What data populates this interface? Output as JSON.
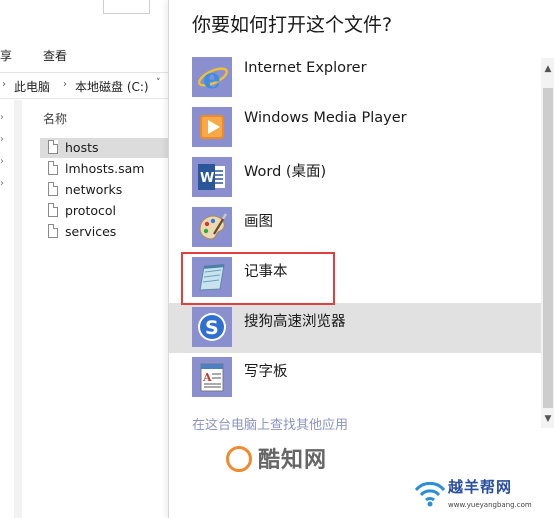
{
  "explorer": {
    "ribbon_tabs": [
      "享",
      "查看"
    ],
    "breadcrumb": [
      "此电脑",
      "本地磁盘 (C:)"
    ],
    "column_header": "名称",
    "files": [
      {
        "name": "hosts",
        "selected": true
      },
      {
        "name": "lmhosts.sam",
        "selected": false
      },
      {
        "name": "networks",
        "selected": false
      },
      {
        "name": "protocol",
        "selected": false
      },
      {
        "name": "services",
        "selected": false
      }
    ]
  },
  "dialog": {
    "title": "你要如何打开这个文件?",
    "apps": [
      {
        "label": "Internet Explorer",
        "icon": "internet-explorer-icon"
      },
      {
        "label": "Windows Media Player",
        "icon": "windows-media-player-icon"
      },
      {
        "label": "Word (桌面)",
        "icon": "word-icon"
      },
      {
        "label": "画图",
        "icon": "paint-icon"
      },
      {
        "label": "记事本",
        "icon": "notepad-icon",
        "annotated": true
      },
      {
        "label": "搜狗高速浏览器",
        "icon": "sogou-browser-icon",
        "highlighted": true
      },
      {
        "label": "写字板",
        "icon": "wordpad-icon"
      }
    ],
    "more_apps_link": "在这台电脑上查找其他应用"
  },
  "watermarks": {
    "primary": "酷知网",
    "secondary": "越羊帮网",
    "secondary_url": "www.yueyangbang.com"
  },
  "colors": {
    "tile_background": "#8a8fd0",
    "highlight_row": "#e1e1e1",
    "annotation_box": "#e04040",
    "link": "#8d93c2"
  }
}
